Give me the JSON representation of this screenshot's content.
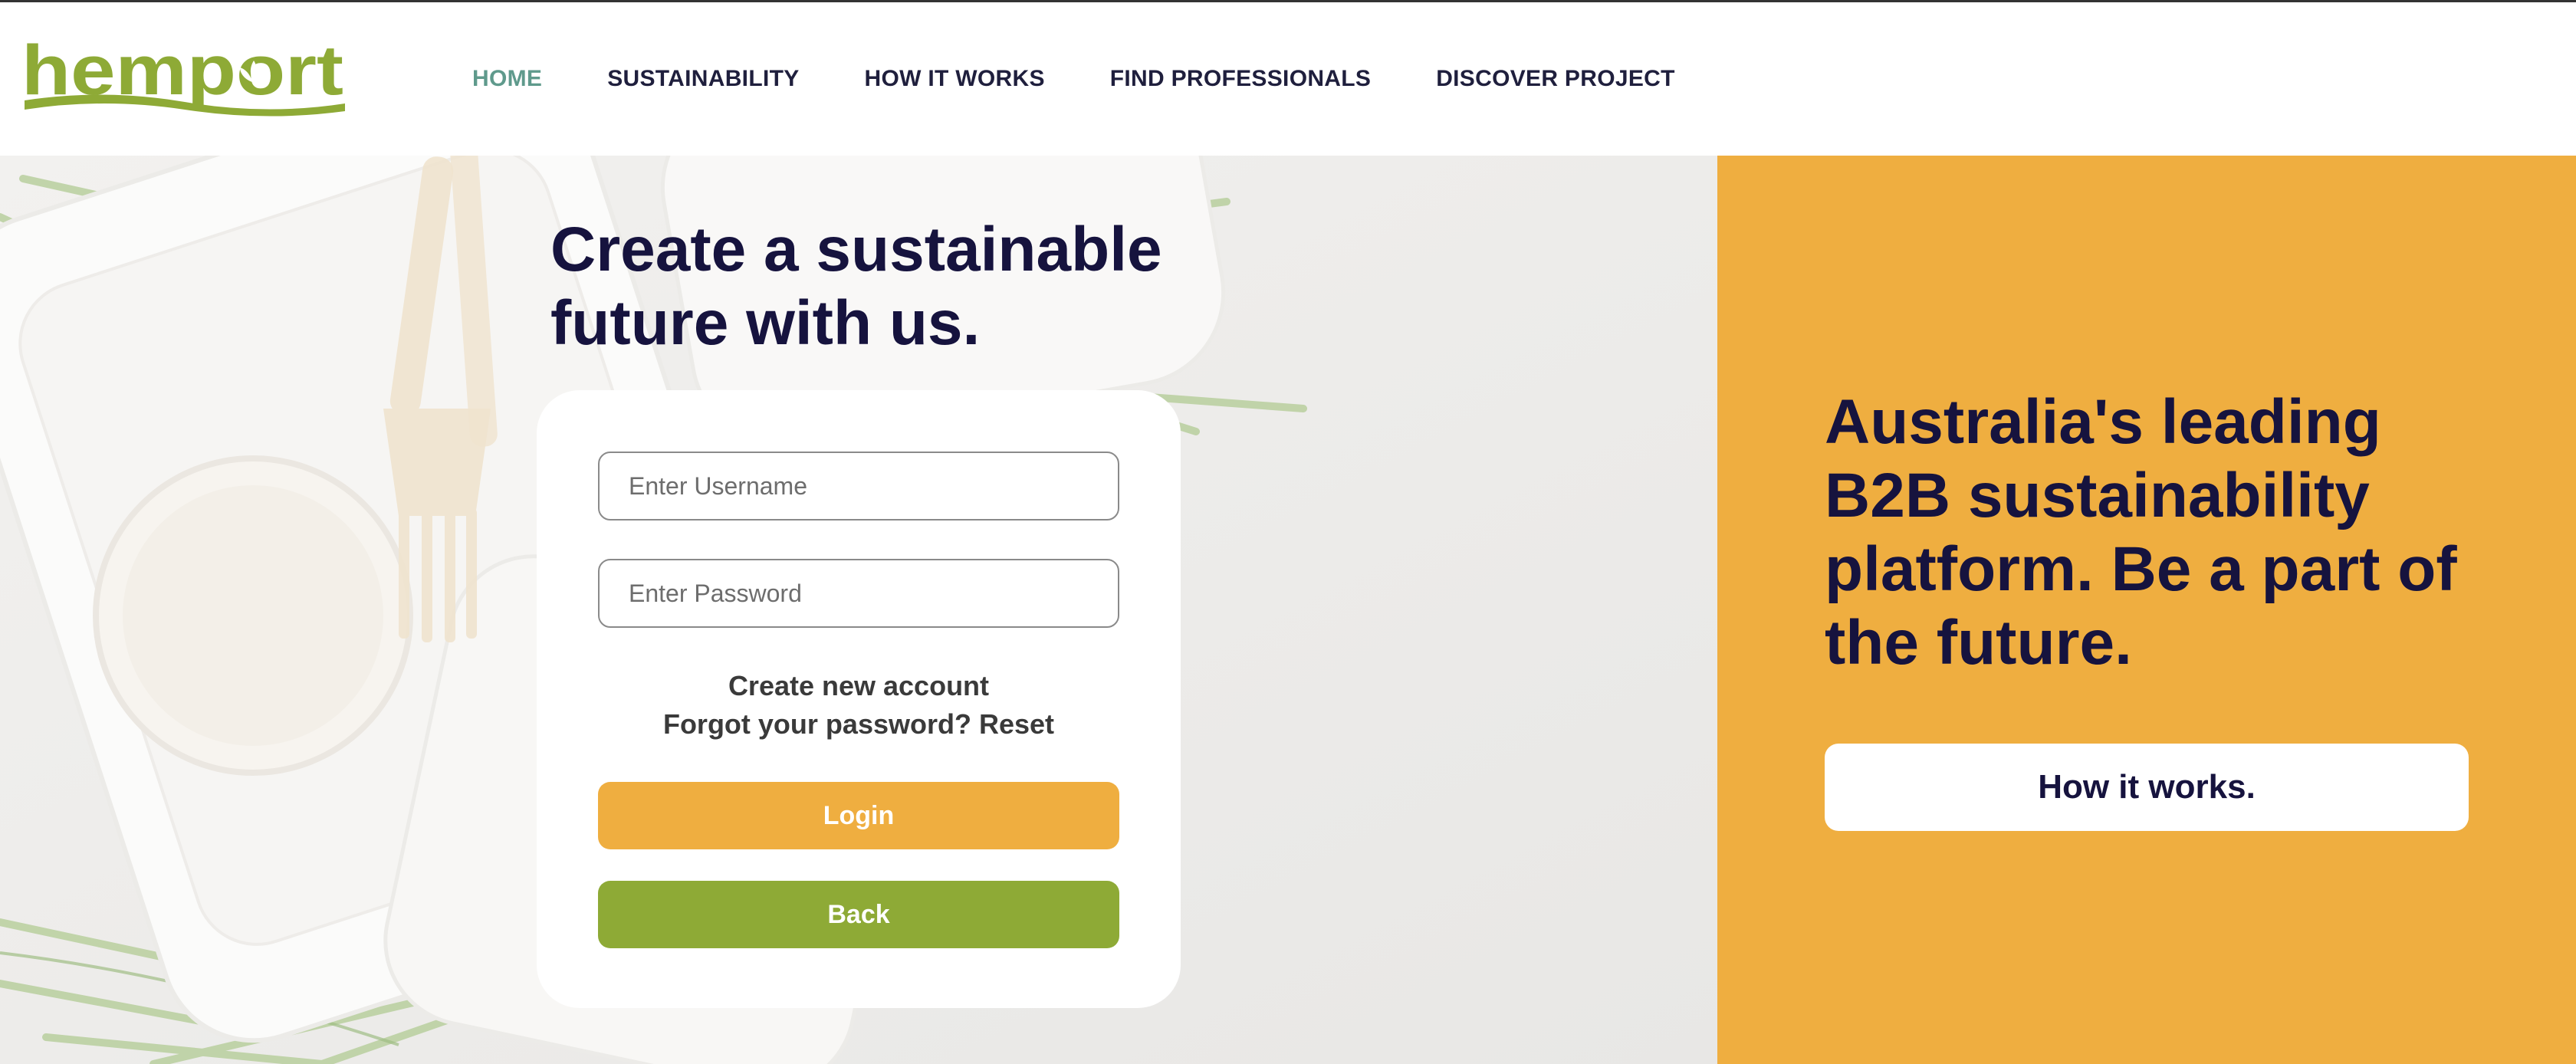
{
  "brand": {
    "name": "hemport",
    "logo_color": "#8eaa36",
    "text_color": "#16133e"
  },
  "nav": {
    "items": [
      {
        "label": "HOME",
        "active": true
      },
      {
        "label": "SUSTAINABILITY",
        "active": false
      },
      {
        "label": "HOW IT WORKS",
        "active": false
      },
      {
        "label": "FIND PROFESSIONALS",
        "active": false
      },
      {
        "label": "DISCOVER PROJECT",
        "active": false
      }
    ],
    "active_color": "#5f9a8c"
  },
  "hero": {
    "headline": "Create a sustainable\nfuture with us."
  },
  "login": {
    "username_placeholder": "Enter Username",
    "password_placeholder": "Enter Password",
    "create_account": "Create new account",
    "forgot_password": "Forgot your password? Reset",
    "login_label": "Login",
    "back_label": "Back",
    "login_color": "#efae40",
    "back_color": "#8eaa36"
  },
  "panel": {
    "text": "Australia's leading B2B sustainability platform. Be a part of the future.",
    "button_label": "How it works.",
    "background": "#efae40"
  }
}
